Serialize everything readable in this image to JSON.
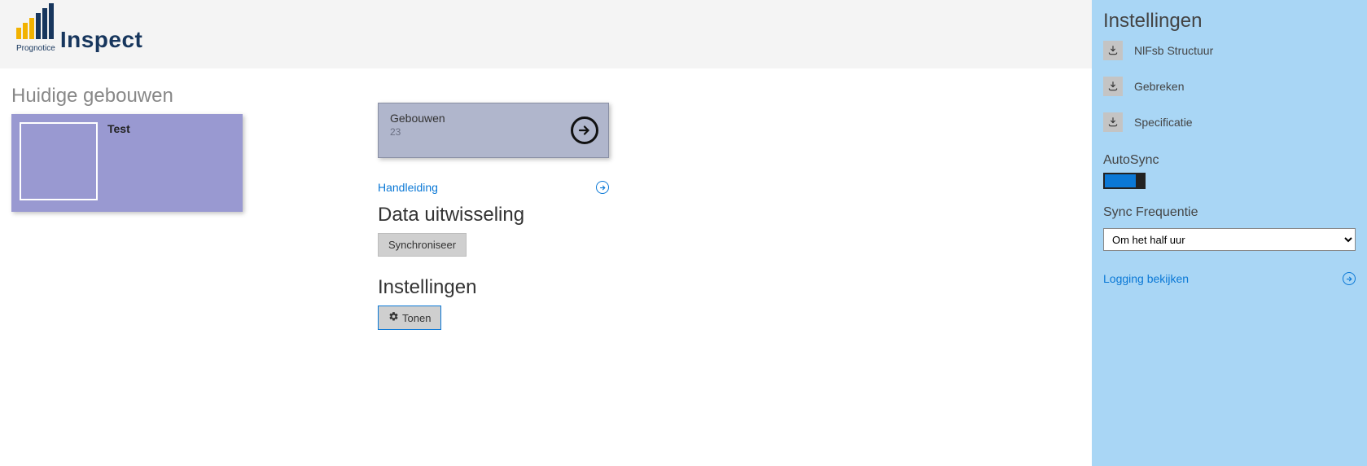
{
  "logo": {
    "brand": "Inspect",
    "subbrand": "Prognotice"
  },
  "main": {
    "huidige_gebouwen_title": "Huidige gebouwen",
    "tile_test_label": "Test",
    "tile_gebouwen_title": "Gebouwen",
    "tile_gebouwen_count": "23",
    "handleiding_label": "Handleiding",
    "data_uitwisseling_title": "Data uitwisseling",
    "sync_button": "Synchroniseer",
    "instellingen_title": "Instellingen",
    "tonen_button": "Tonen"
  },
  "sidebar": {
    "title": "Instellingen",
    "items": [
      {
        "label": "NlFsb Structuur"
      },
      {
        "label": "Gebreken"
      },
      {
        "label": "Specificatie"
      }
    ],
    "autosync_label": "AutoSync",
    "autosync_on": true,
    "sync_freq_label": "Sync Frequentie",
    "sync_freq_value": "Om het half uur",
    "logging_label": "Logging bekijken"
  }
}
